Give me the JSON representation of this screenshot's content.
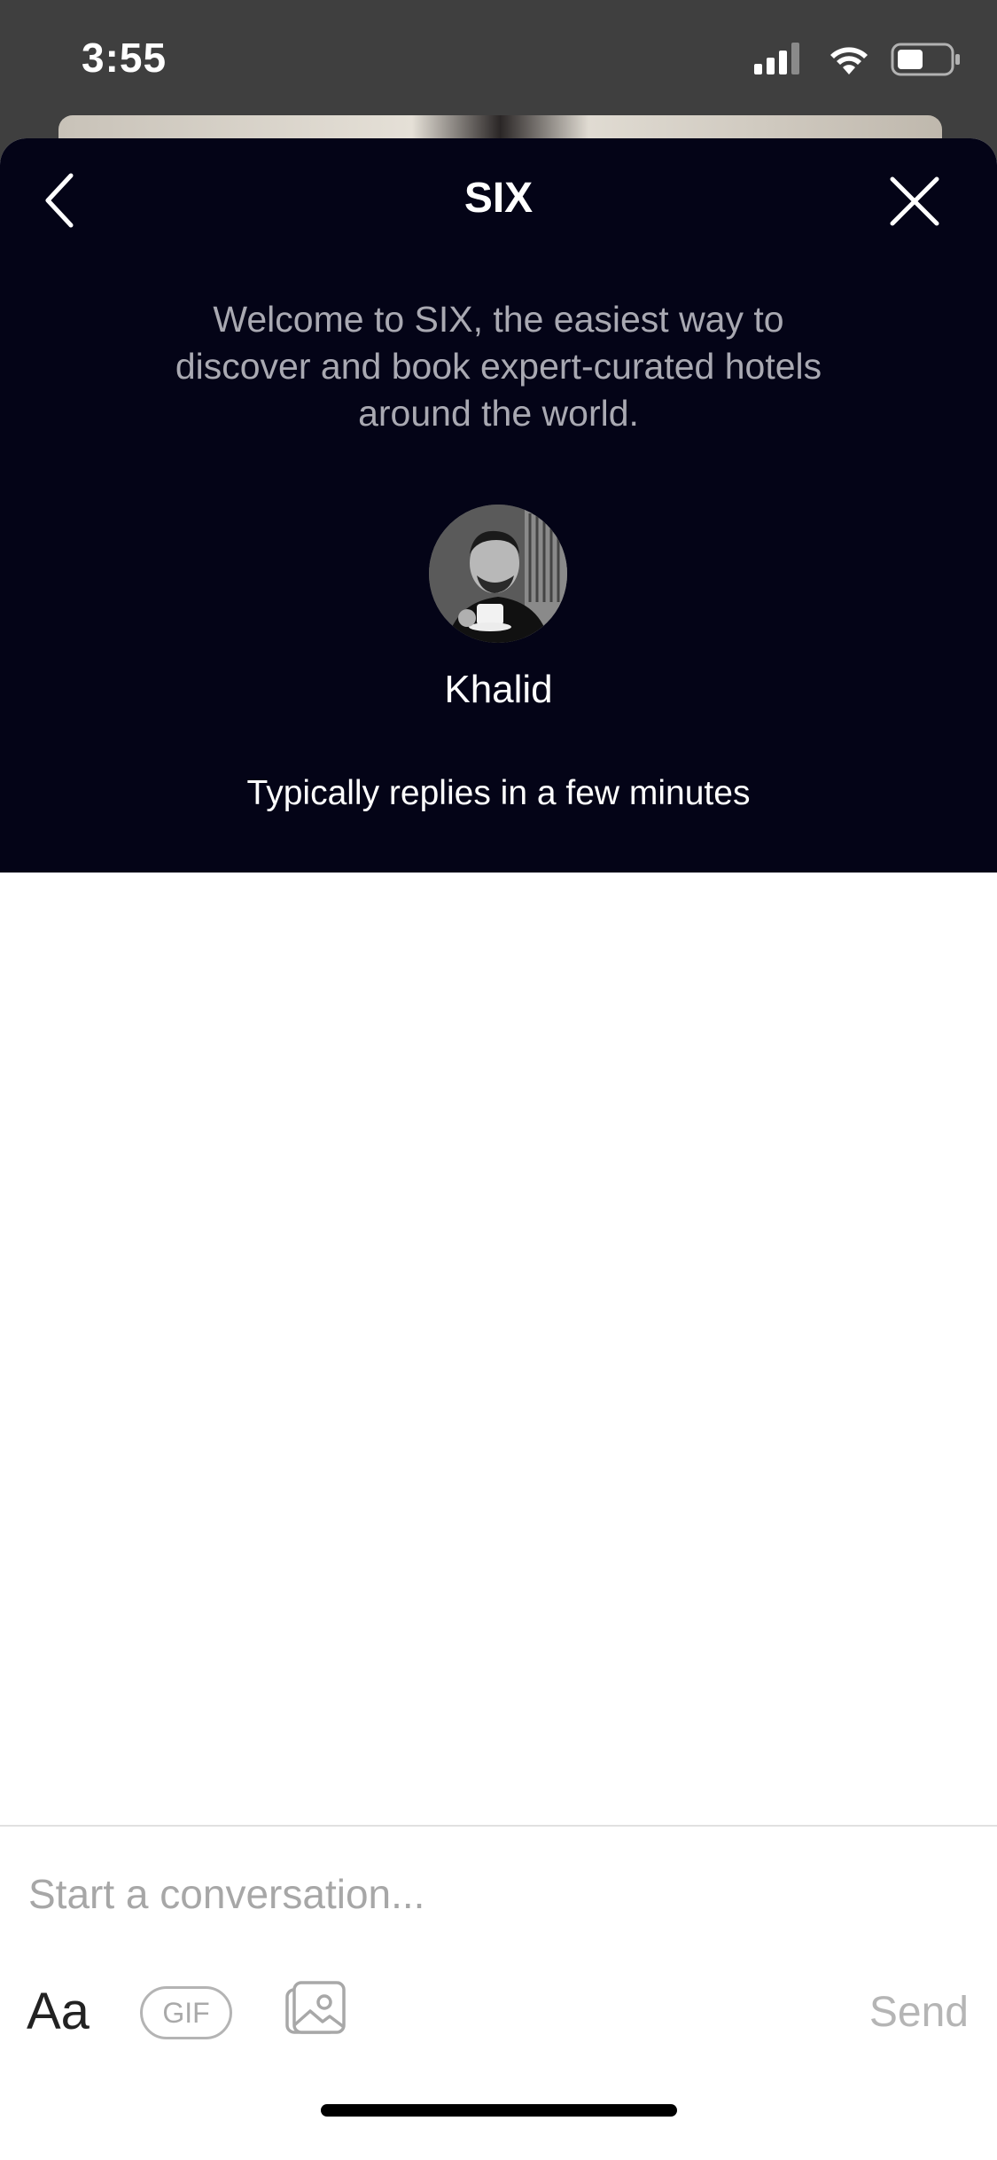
{
  "status_bar": {
    "time": "3:55"
  },
  "header": {
    "title": "SIX",
    "welcome_text": "Welcome to SIX, the easiest way to discover and book expert-curated hotels around the world.",
    "agent_name": "Khalid",
    "reply_time": "Typically replies in a few minutes",
    "icons": {
      "back": "chevron-left-icon",
      "close": "close-icon"
    }
  },
  "composer": {
    "placeholder": "Start a conversation...",
    "value": "",
    "font_button": "Aa",
    "gif_button": "GIF",
    "send_button": "Send",
    "icons": {
      "image": "image-icon"
    }
  },
  "colors": {
    "header_background": "#040417",
    "status_bar_background": "#3f3f3f",
    "welcome_text": "#a9a9b2",
    "send_disabled": "#b5b5b5"
  }
}
